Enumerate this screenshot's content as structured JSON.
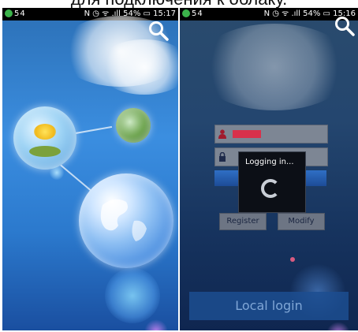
{
  "caption": {
    "text": "для подключения к облаку."
  },
  "left_screen": {
    "status_bar": {
      "right_text": "N ◷ ᯤ .ıll 54% ▭ 15:17",
      "badge": "54"
    }
  },
  "right_screen": {
    "status_bar": {
      "right_text": "N ◷ ᯤ .ıll 54% ▭ 15:16",
      "badge": "54"
    },
    "login": {
      "username_value": "",
      "register_label": "Register",
      "modify_label": "Modify",
      "local_login_label": "Local login"
    },
    "dialog": {
      "title": "Logging in..."
    }
  },
  "icons": {
    "search": "search-icon",
    "user": "user-icon",
    "lock": "lock-icon"
  },
  "colors": {
    "left_bg": "#3b8ee0",
    "right_bg": "#16335e",
    "field_bg": "#7d8694",
    "login_bar": "#2f6fc5",
    "dialog_bg": "#0c0f16",
    "local_login_text": "#7fa6d6"
  }
}
